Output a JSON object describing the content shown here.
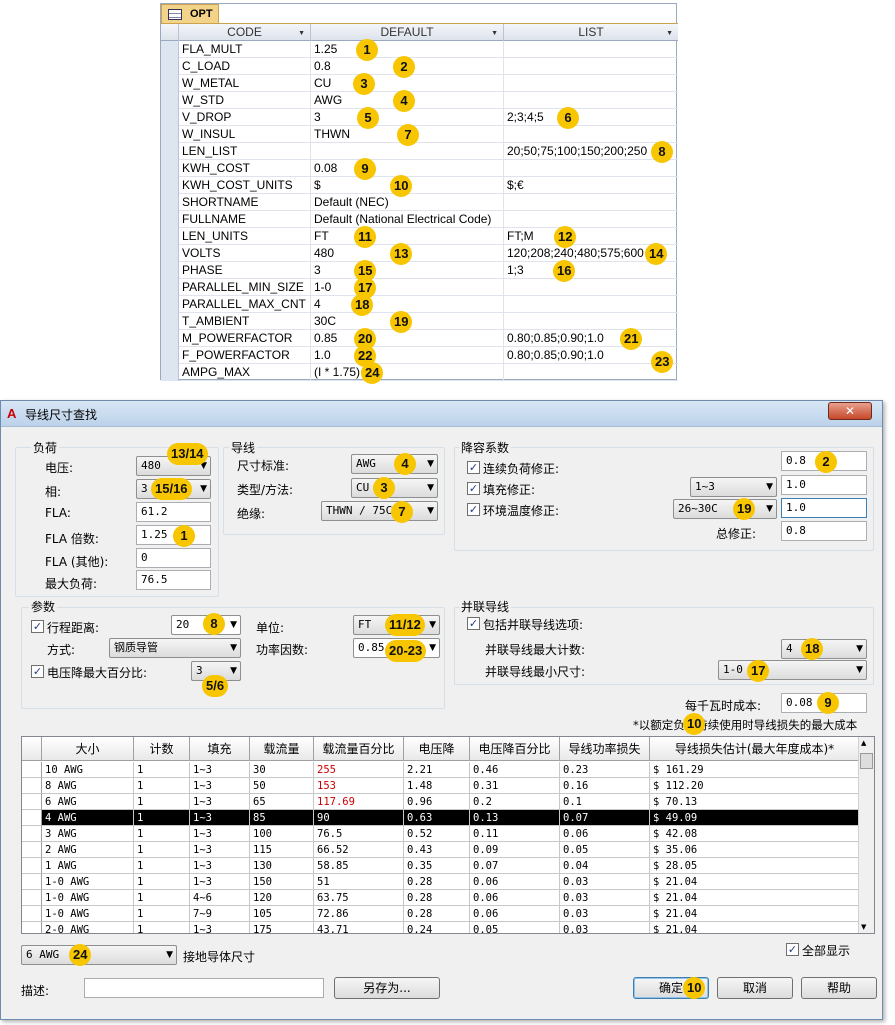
{
  "table": {
    "tab_label": "OPT",
    "columns": [
      "CODE",
      "DEFAULT",
      "LIST"
    ],
    "rows": [
      {
        "code": "FLA_MULT",
        "default": "1.25",
        "list": "",
        "badge": "1"
      },
      {
        "code": "C_LOAD",
        "default": "0.8",
        "list": "",
        "badge": "2"
      },
      {
        "code": "W_METAL",
        "default": "CU",
        "list": "",
        "badge": "3"
      },
      {
        "code": "W_STD",
        "default": "AWG",
        "list": "",
        "badge": "4"
      },
      {
        "code": "V_DROP",
        "default": "3",
        "list": "2;3;4;5",
        "badge": "5",
        "badge2": "6"
      },
      {
        "code": "W_INSUL",
        "default": "THWN",
        "list": "",
        "badge": "7"
      },
      {
        "code": "LEN_LIST",
        "default": "",
        "list": "20;50;75;100;150;200;250",
        "badge2": "8"
      },
      {
        "code": "KWH_COST",
        "default": "0.08",
        "list": "",
        "badge": "9"
      },
      {
        "code": "KWH_COST_UNITS",
        "default": "$",
        "list": "$;€",
        "badge": "10"
      },
      {
        "code": "SHORTNAME",
        "default": "Default (NEC)",
        "list": ""
      },
      {
        "code": "FULLNAME",
        "default": "Default (National Electrical Code)",
        "list": ""
      },
      {
        "code": "LEN_UNITS",
        "default": "FT",
        "list": "FT;M",
        "badge": "11",
        "badge2": "12"
      },
      {
        "code": "VOLTS",
        "default": "480",
        "list": "120;208;240;480;575;600",
        "badge": "13",
        "badge2": "14"
      },
      {
        "code": "PHASE",
        "default": "3",
        "list": "1;3",
        "badge": "15",
        "badge2": "16"
      },
      {
        "code": "PARALLEL_MIN_SIZE",
        "default": "1-0",
        "list": "",
        "badge": "17"
      },
      {
        "code": "PARALLEL_MAX_CNT",
        "default": "4",
        "list": "",
        "badge": "18"
      },
      {
        "code": "T_AMBIENT",
        "default": "30C",
        "list": "",
        "badge": "19"
      },
      {
        "code": "M_POWERFACTOR",
        "default": "0.85",
        "list": "0.80;0.85;0.90;1.0",
        "badge": "20",
        "badge2": "21"
      },
      {
        "code": "F_POWERFACTOR",
        "default": "1.0",
        "list": "0.80;0.85;0.90;1.0",
        "badge": "22",
        "badge2": "23"
      },
      {
        "code": "AMPG_MAX",
        "default": "(I * 1.75)",
        "list": "",
        "badge": "24"
      }
    ]
  },
  "dialog": {
    "title": "导线尺寸查找",
    "close": "✕",
    "load": {
      "group": "负荷",
      "voltage_label": "电压:",
      "voltage": "480",
      "voltage_badge": "13/14",
      "phase_label": "相:",
      "phase": "3",
      "phase_badge": "15/16",
      "fla_label": "FLA:",
      "fla": "61.2",
      "fla_mult_label": "FLA 倍数:",
      "fla_mult": "1.25",
      "fla_mult_badge": "1",
      "fla_other_label": "FLA (其他):",
      "fla_other": "0",
      "max_load_label": "最大负荷:",
      "max_load": "76.5"
    },
    "wire": {
      "group": "导线",
      "std_label": "尺寸标准:",
      "std": "AWG",
      "std_badge": "4",
      "type_label": "类型/方法:",
      "type": "CU",
      "type_badge": "3",
      "insul_label": "绝缘:",
      "insul": "THWN / 75C",
      "insul_badge": "7"
    },
    "derate": {
      "group": "降容系数",
      "cont_label": "连续负荷修正:",
      "cont": "0.8",
      "cont_badge": "2",
      "fill_label": "填充修正:",
      "fill_sel": "1~3",
      "fill": "1.0",
      "temp_label": "环境温度修正:",
      "temp_sel": "26~30C",
      "temp": "1.0",
      "temp_badge": "19",
      "total_label": "总修正:",
      "total": "0.8"
    },
    "params": {
      "group": "参数",
      "dist_label": "行程距离:",
      "dist": "20",
      "dist_badge": "8",
      "unit_label": "单位:",
      "unit": "FT",
      "unit_badge": "11/12",
      "method_label": "方式:",
      "method": "钢质导管",
      "pf_label": "功率因数:",
      "pf": "0.85",
      "pf_badge": "20-23",
      "vdrop_label": "电压降最大百分比:",
      "vdrop": "3",
      "vdrop_badge": "5/6"
    },
    "parallel": {
      "group": "并联导线",
      "include_label": "包括并联导线选项:",
      "max_label": "并联导线最大计数:",
      "max": "4",
      "max_badge": "18",
      "min_label": "并联导线最小尺寸:",
      "min": "1-0",
      "min_badge": "17"
    },
    "cost_label": "每千瓦时成本:",
    "cost": "0.08",
    "cost_badge": "9",
    "cost_note": "*以额定负荷持续使用时导线损失的最大成本",
    "cost_note_badge": "10",
    "grid": {
      "headers": [
        "大小",
        "计数",
        "填充",
        "载流量",
        "载流量百分比",
        "电压降",
        "电压降百分比",
        "导线功率损失",
        "导线损失估计(最大年度成本)*"
      ],
      "rows": [
        [
          "10 AWG",
          "1",
          "1~3",
          "30",
          "255",
          "2.21",
          "0.46",
          "0.23",
          "$ 161.29"
        ],
        [
          "8 AWG",
          "1",
          "1~3",
          "50",
          "153",
          "1.48",
          "0.31",
          "0.16",
          "$ 112.20"
        ],
        [
          "6 AWG",
          "1",
          "1~3",
          "65",
          "117.69",
          "0.96",
          "0.2",
          "0.1",
          "$ 70.13"
        ],
        [
          "4 AWG",
          "1",
          "1~3",
          "85",
          "90",
          "0.63",
          "0.13",
          "0.07",
          "$ 49.09"
        ],
        [
          "3 AWG",
          "1",
          "1~3",
          "100",
          "76.5",
          "0.52",
          "0.11",
          "0.06",
          "$ 42.08"
        ],
        [
          "2 AWG",
          "1",
          "1~3",
          "115",
          "66.52",
          "0.43",
          "0.09",
          "0.05",
          "$ 35.06"
        ],
        [
          "1 AWG",
          "1",
          "1~3",
          "130",
          "58.85",
          "0.35",
          "0.07",
          "0.04",
          "$ 28.05"
        ],
        [
          "1-0 AWG",
          "1",
          "1~3",
          "150",
          "51",
          "0.28",
          "0.06",
          "0.03",
          "$ 21.04"
        ],
        [
          "1-0 AWG",
          "1",
          "4~6",
          "120",
          "63.75",
          "0.28",
          "0.06",
          "0.03",
          "$ 21.04"
        ],
        [
          "1-0 AWG",
          "1",
          "7~9",
          "105",
          "72.86",
          "0.28",
          "0.06",
          "0.03",
          "$ 21.04"
        ],
        [
          "2-0 AWG",
          "1",
          "1~3",
          "175",
          "43.71",
          "0.24",
          "0.05",
          "0.03",
          "$ 21.04"
        ]
      ],
      "selected_row": 3,
      "red_color": "#cc0000"
    },
    "ground_sel": "6 AWG",
    "ground_badge": "24",
    "ground_label": "接地导体尺寸",
    "show_all_label": "全部显示",
    "desc_label": "描述:",
    "save_as": "另存为...",
    "ok": "确定",
    "ok_badge": "10",
    "cancel": "取消",
    "help": "帮助"
  }
}
